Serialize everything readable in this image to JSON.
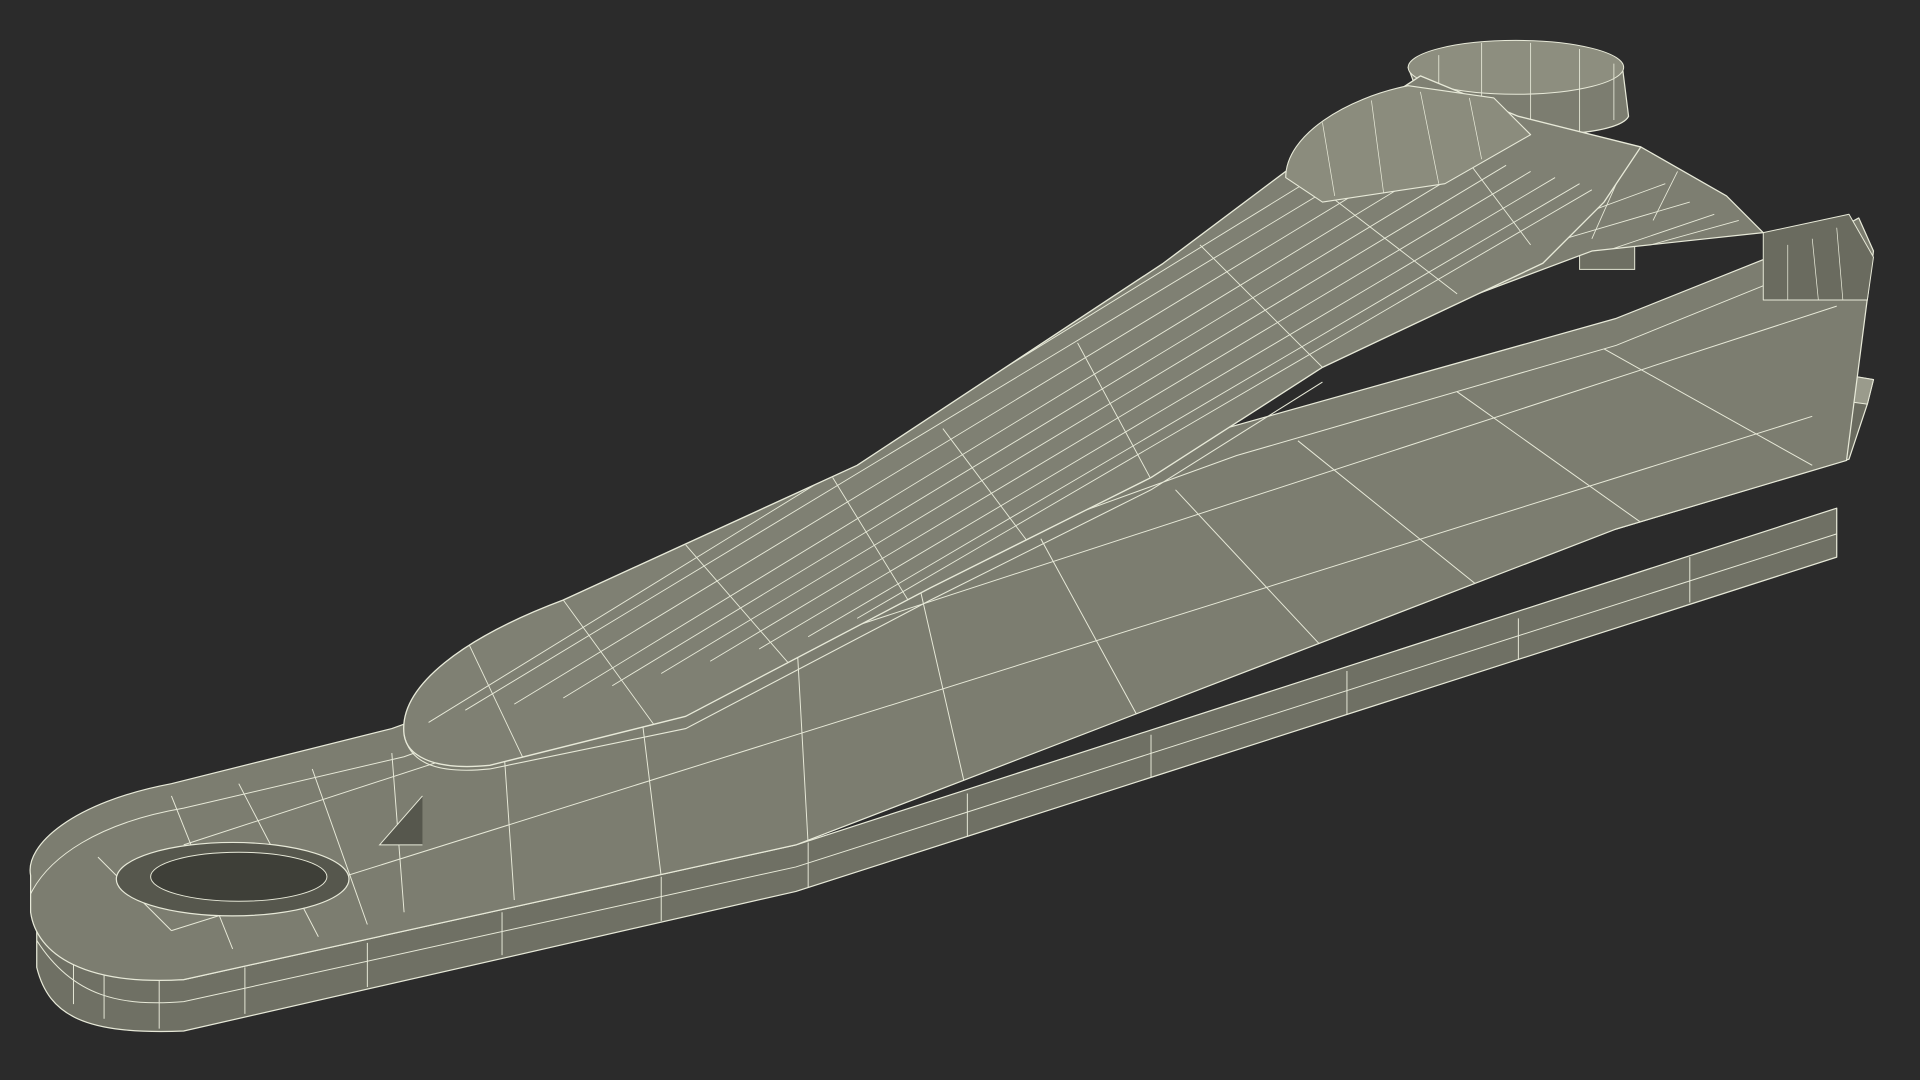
{
  "scene": {
    "subject": "nail-clipper-wireframe-render",
    "colors": {
      "background": "#2b2b2b",
      "surface": "#7b7c6e",
      "surface_light": "#8a8b7c",
      "surface_dark": "#5e5f54",
      "shadow": "#3e3f38",
      "wire": "#e7e9d8",
      "edge": "#404138"
    }
  }
}
